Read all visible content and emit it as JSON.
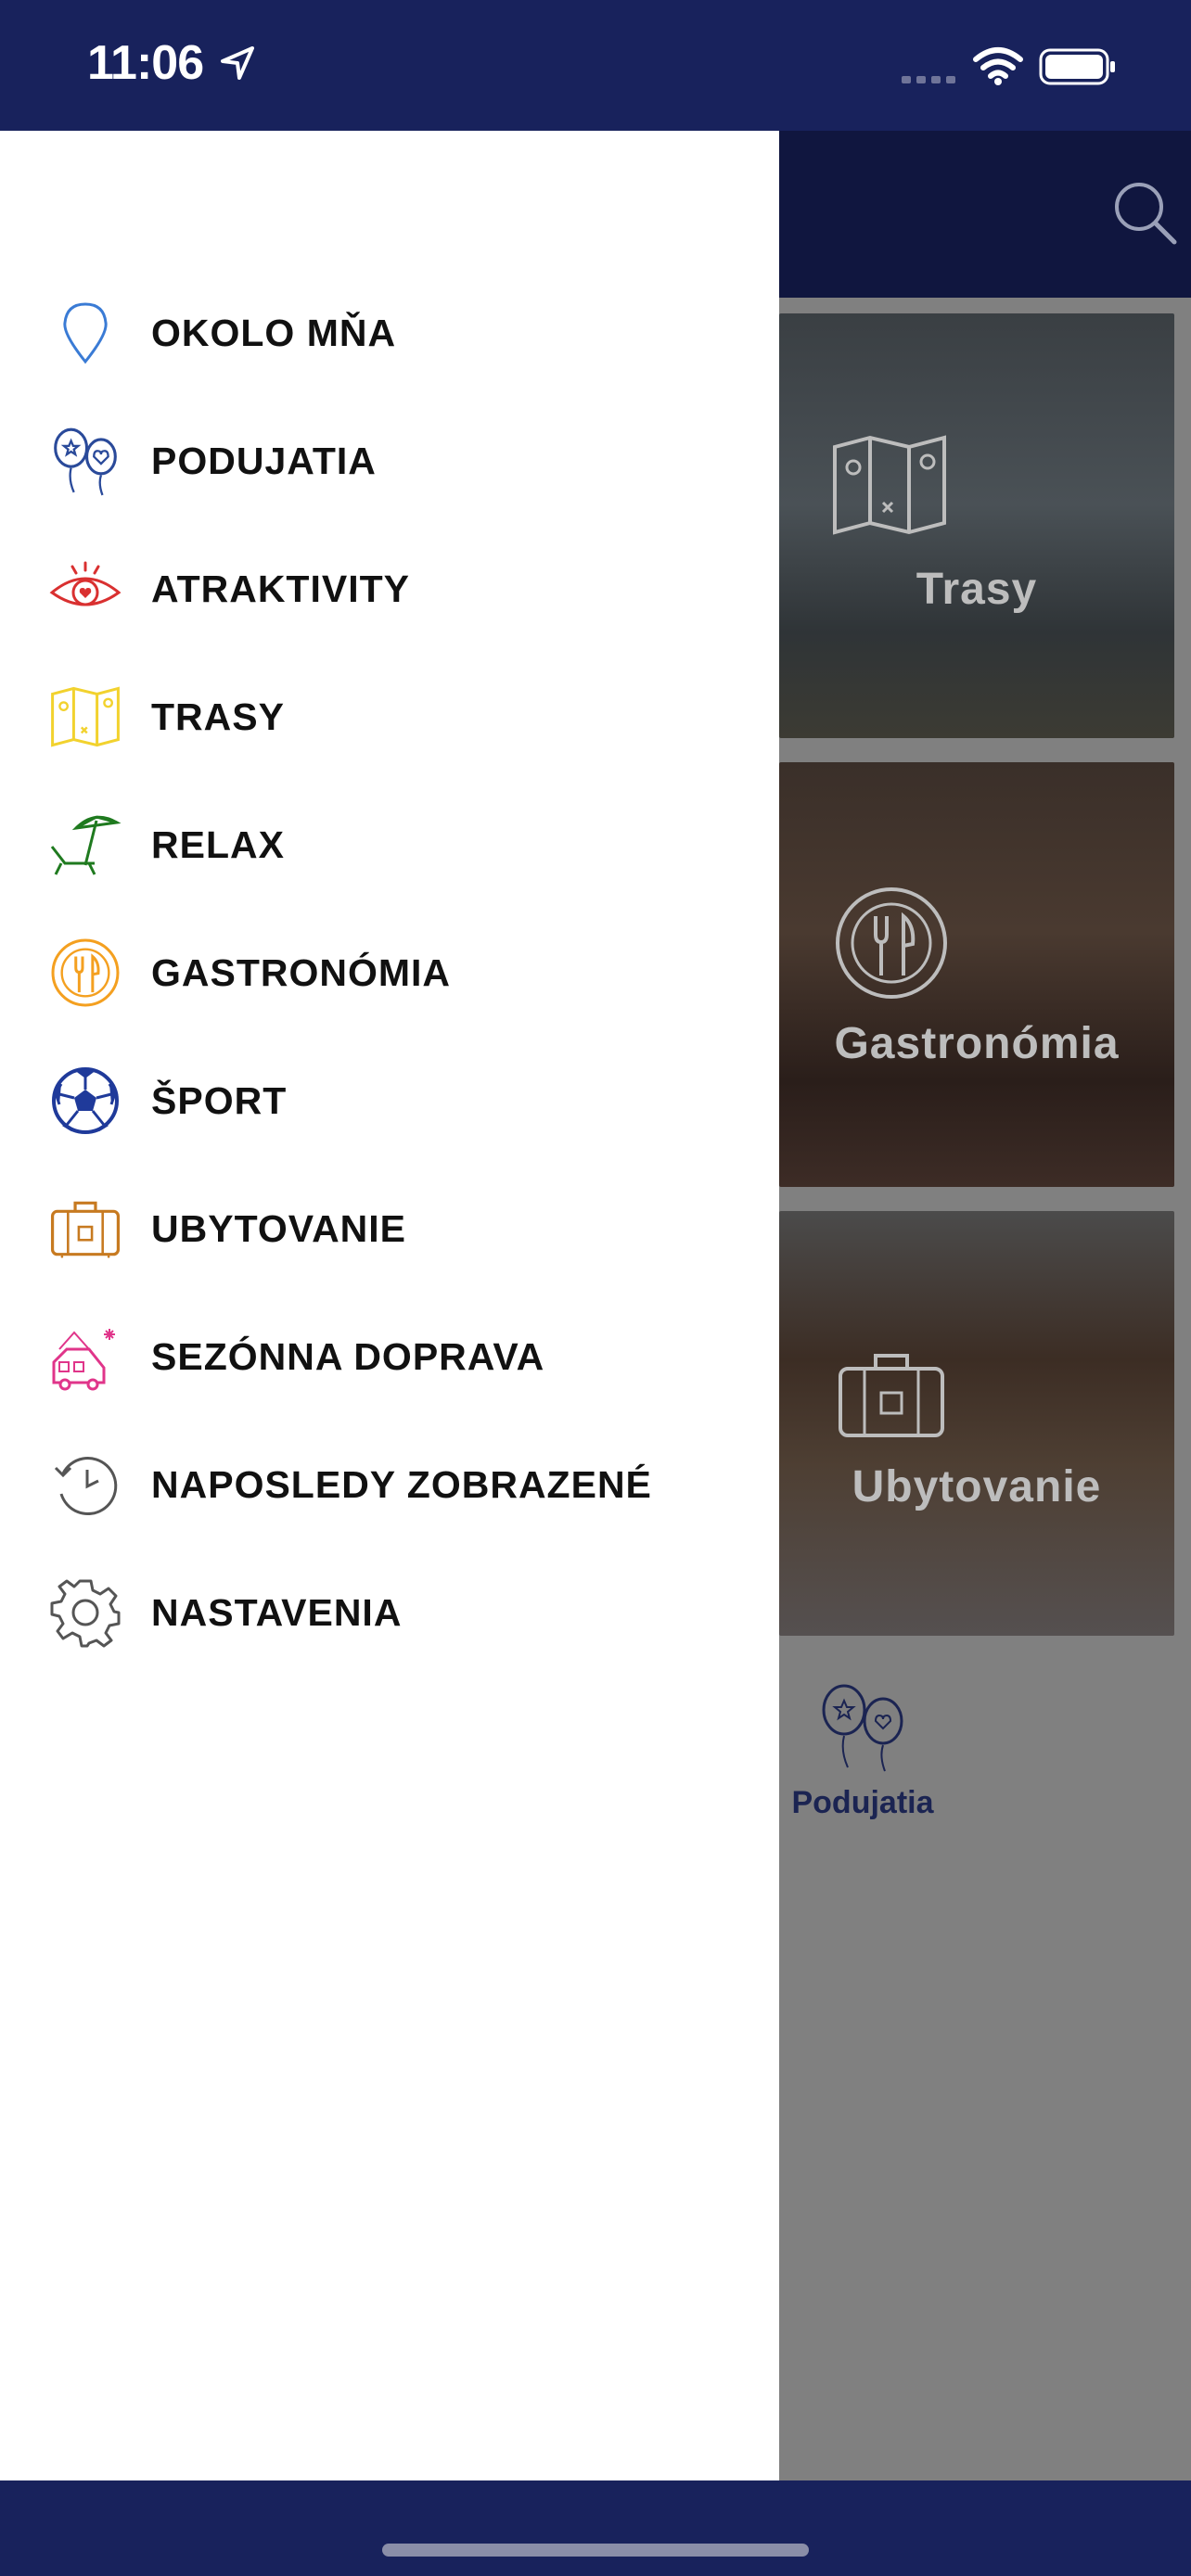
{
  "status_bar": {
    "time": "11:06"
  },
  "background": {
    "tiles": [
      {
        "label": "Trasy"
      },
      {
        "label": "Gastronómia"
      },
      {
        "label": "Ubytovanie"
      }
    ],
    "podujatia_label": "Podujatia"
  },
  "menu": {
    "items": [
      {
        "label": "OKOLO MŇA",
        "icon": "location-pin-icon",
        "color": "#3a7bd5"
      },
      {
        "label": "PODUJATIA",
        "icon": "balloons-icon",
        "color": "#2a4a9a"
      },
      {
        "label": "ATRAKTIVITY",
        "icon": "eye-heart-icon",
        "color": "#d93030"
      },
      {
        "label": "TRASY",
        "icon": "map-icon",
        "color": "#f2d22e"
      },
      {
        "label": "RELAX",
        "icon": "beach-chair-icon",
        "color": "#1f7a1f"
      },
      {
        "label": "GASTRONÓMIA",
        "icon": "plate-cutlery-icon",
        "color": "#f4a020"
      },
      {
        "label": "ŠPORT",
        "icon": "soccer-ball-icon",
        "color": "#1f3a9a"
      },
      {
        "label": "UBYTOVANIE",
        "icon": "suitcase-icon",
        "color": "#c77a20"
      },
      {
        "label": "SEZÓNNA DOPRAVA",
        "icon": "bus-icon",
        "color": "#e0358a"
      },
      {
        "label": "NAPOSLEDY ZOBRAZENÉ",
        "icon": "history-icon",
        "color": "#555555"
      },
      {
        "label": "NASTAVENIA",
        "icon": "gear-icon",
        "color": "#555555"
      }
    ]
  }
}
